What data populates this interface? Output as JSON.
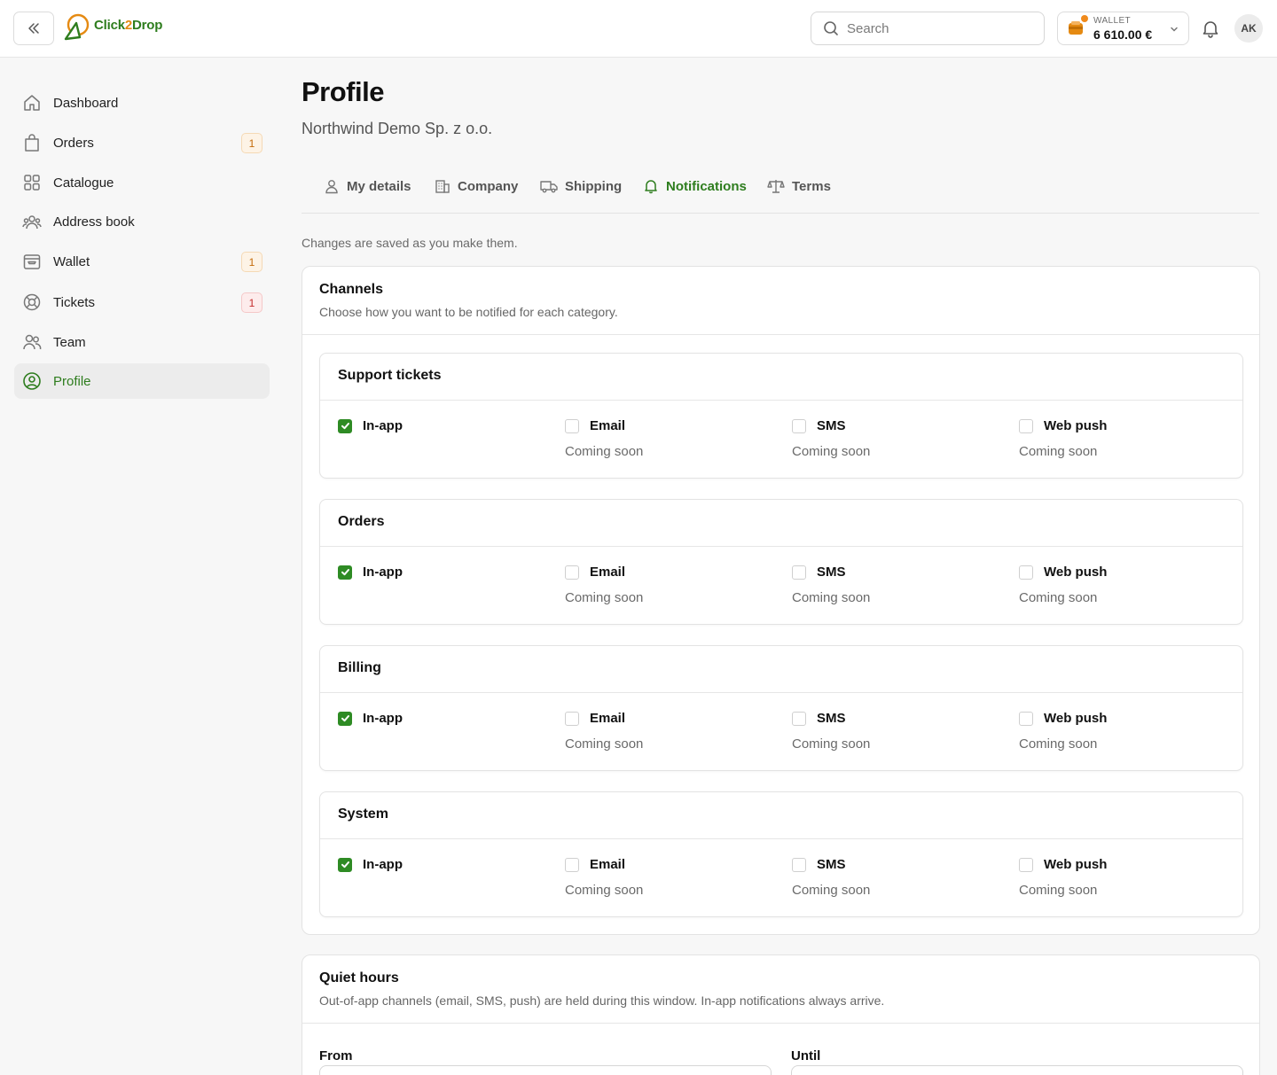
{
  "header": {
    "brand": {
      "part1": "Click",
      "part2": "2",
      "part3": "Drop"
    },
    "search_placeholder": "Search",
    "wallet": {
      "label": "WALLET",
      "amount": "6 610.00 €"
    },
    "avatar_initials": "AK"
  },
  "sidebar": {
    "items": [
      {
        "label": "Dashboard",
        "icon": "home-icon"
      },
      {
        "label": "Orders",
        "icon": "bag-icon",
        "badge": "1"
      },
      {
        "label": "Catalogue",
        "icon": "grid-icon"
      },
      {
        "label": "Address book",
        "icon": "users-group-icon"
      },
      {
        "label": "Wallet",
        "icon": "wallet-icon",
        "badge": "1"
      },
      {
        "label": "Tickets",
        "icon": "lifebuoy-icon",
        "badge": "1"
      },
      {
        "label": "Team",
        "icon": "team-icon"
      },
      {
        "label": "Profile",
        "icon": "user-circle-icon",
        "active": true
      }
    ]
  },
  "page": {
    "title": "Profile",
    "subtitle": "Northwind Demo Sp. z o.o.",
    "tabs": [
      {
        "label": "My details",
        "icon": "user-icon"
      },
      {
        "label": "Company",
        "icon": "building-icon"
      },
      {
        "label": "Shipping",
        "icon": "truck-icon"
      },
      {
        "label": "Notifications",
        "icon": "bell-icon",
        "active": true
      },
      {
        "label": "Terms",
        "icon": "scale-icon"
      }
    ],
    "hint": "Changes are saved as you make them."
  },
  "channels": {
    "title": "Channels",
    "description": "Choose how you want to be notified for each category.",
    "coming_soon": "Coming soon",
    "channel_labels": [
      "In-app",
      "Email",
      "SMS",
      "Web push"
    ],
    "categories": [
      {
        "name": "Support tickets",
        "checked": [
          true,
          false,
          false,
          false
        ]
      },
      {
        "name": "Orders",
        "checked": [
          true,
          false,
          false,
          false
        ]
      },
      {
        "name": "Billing",
        "checked": [
          true,
          false,
          false,
          false
        ]
      },
      {
        "name": "System",
        "checked": [
          true,
          false,
          false,
          false
        ]
      }
    ]
  },
  "quiet_hours": {
    "title": "Quiet hours",
    "description": "Out-of-app channels (email, SMS, push) are held during this window. In-app notifications always arrive.",
    "from_label": "From",
    "until_label": "Until"
  },
  "colors": {
    "accent": "#2e7d1e",
    "brand_orange": "#e58a12",
    "badge_orange": "#c46a09",
    "badge_red": "#c42a2a"
  }
}
